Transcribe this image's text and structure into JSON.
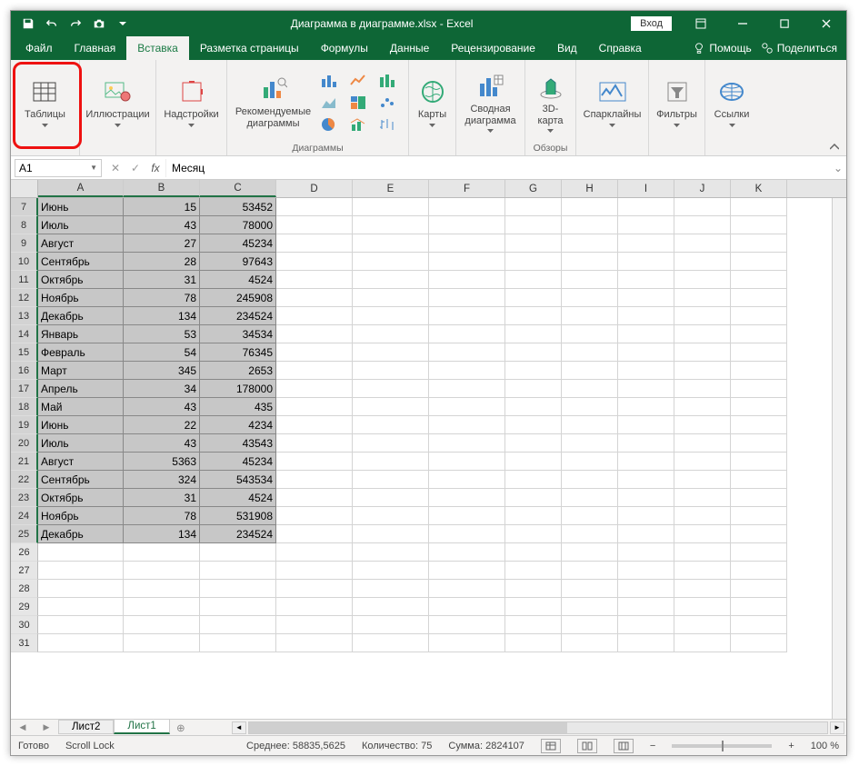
{
  "title": "Диаграмма в диаграмме.xlsx - Excel",
  "login_label": "Вход",
  "tabs": {
    "file": "Файл",
    "home": "Главная",
    "insert": "Вставка",
    "layout": "Разметка страницы",
    "formulas": "Формулы",
    "data": "Данные",
    "review": "Рецензирование",
    "view": "Вид",
    "help": "Справка",
    "tellme": "Помощь",
    "share": "Поделиться"
  },
  "ribbon": {
    "tables": "Таблицы",
    "illustrations": "Иллюстрации",
    "addins": "Надстройки",
    "rec_charts": "Рекомендуемые\nдиаграммы",
    "charts_group": "Диаграммы",
    "maps": "Карты",
    "pivot_chart": "Сводная\nдиаграмма",
    "tours_group": "Обзоры",
    "map3d": "3D-\nкарта",
    "sparklines": "Спарклайны",
    "filters": "Фильтры",
    "links": "Ссылки"
  },
  "namebox": "A1",
  "formula_value": "Месяц",
  "columns": [
    "A",
    "B",
    "C",
    "D",
    "E",
    "F",
    "G",
    "H",
    "I",
    "J",
    "K"
  ],
  "row_start": 7,
  "data_rows": [
    {
      "n": 7,
      "a": "Июнь",
      "b": 15,
      "c": 53452
    },
    {
      "n": 8,
      "a": "Июль",
      "b": 43,
      "c": 78000
    },
    {
      "n": 9,
      "a": "Август",
      "b": 27,
      "c": 45234
    },
    {
      "n": 10,
      "a": "Сентябрь",
      "b": 28,
      "c": 97643
    },
    {
      "n": 11,
      "a": "Октябрь",
      "b": 31,
      "c": 4524
    },
    {
      "n": 12,
      "a": "Ноябрь",
      "b": 78,
      "c": 245908
    },
    {
      "n": 13,
      "a": "Декабрь",
      "b": 134,
      "c": 234524
    },
    {
      "n": 14,
      "a": "Январь",
      "b": 53,
      "c": 34534
    },
    {
      "n": 15,
      "a": "Февраль",
      "b": 54,
      "c": 76345
    },
    {
      "n": 16,
      "a": "Март",
      "b": 345,
      "c": 2653
    },
    {
      "n": 17,
      "a": "Апрель",
      "b": 34,
      "c": 178000
    },
    {
      "n": 18,
      "a": "Май",
      "b": 43,
      "c": 435
    },
    {
      "n": 19,
      "a": "Июнь",
      "b": 22,
      "c": 4234
    },
    {
      "n": 20,
      "a": "Июль",
      "b": 43,
      "c": 43543
    },
    {
      "n": 21,
      "a": "Август",
      "b": 5363,
      "c": 45234
    },
    {
      "n": 22,
      "a": "Сентябрь",
      "b": 324,
      "c": 543534
    },
    {
      "n": 23,
      "a": "Октябрь",
      "b": 31,
      "c": 4524
    },
    {
      "n": 24,
      "a": "Ноябрь",
      "b": 78,
      "c": 531908
    },
    {
      "n": 25,
      "a": "Декабрь",
      "b": 134,
      "c": 234524
    }
  ],
  "empty_rows": [
    26,
    27,
    28,
    29,
    30,
    31
  ],
  "sheets": {
    "sheet2": "Лист2",
    "sheet1": "Лист1"
  },
  "status": {
    "ready": "Готово",
    "scrolllock": "Scroll Lock",
    "avg_label": "Среднее:",
    "avg_val": "58835,5625",
    "count_label": "Количество:",
    "count_val": "75",
    "sum_label": "Сумма:",
    "sum_val": "2824107",
    "zoom": "100 %"
  }
}
